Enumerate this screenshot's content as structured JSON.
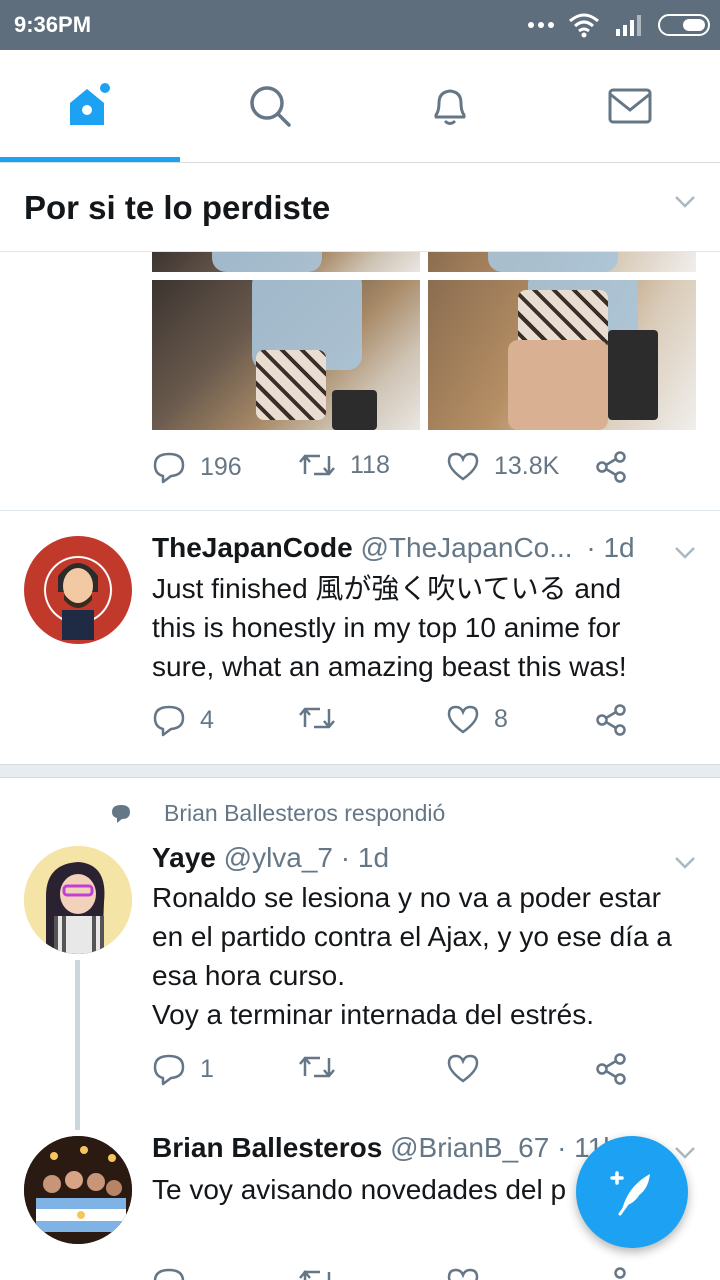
{
  "status_bar": {
    "time": "9:36PM"
  },
  "tabs": [
    {
      "name": "home",
      "icon": "home-icon",
      "active": true
    },
    {
      "name": "search",
      "icon": "search-icon"
    },
    {
      "name": "notifications",
      "icon": "bell-icon"
    },
    {
      "name": "messages",
      "icon": "mail-icon"
    }
  ],
  "section_header": {
    "title": "Por si te lo perdiste"
  },
  "tweet0": {
    "replies": "196",
    "retweets": "118",
    "likes": "13.8K"
  },
  "tweet1": {
    "name": "TheJapanCode",
    "handle": "@TheJapanCo...",
    "time": "· 1d",
    "text_lines": [
      "Just finished 風が強く吹いている and",
      "this is honestly in my top 10 anime for",
      "sure, what an amazing beast this was!"
    ],
    "replies": "4",
    "likes": "8"
  },
  "tweet2": {
    "social_context": "Brian Ballesteros respondió",
    "name": "Yaye",
    "handle": "@ylva_7",
    "time": "· 1d",
    "text_lines": [
      "Ronaldo se lesiona y no va a poder estar",
      "en el partido contra el Ajax, y yo ese día a",
      "esa hora curso.",
      "Voy a terminar internada del estrés."
    ],
    "replies": "1"
  },
  "tweet3": {
    "name": "Brian Ballesteros",
    "handle": "@BrianB_67",
    "time": "· 11h",
    "text": "Te voy avisando novedades del p"
  },
  "colors": {
    "accent": "#1da1f2",
    "status_bar": "#5e6e7d",
    "muted": "#657786"
  }
}
